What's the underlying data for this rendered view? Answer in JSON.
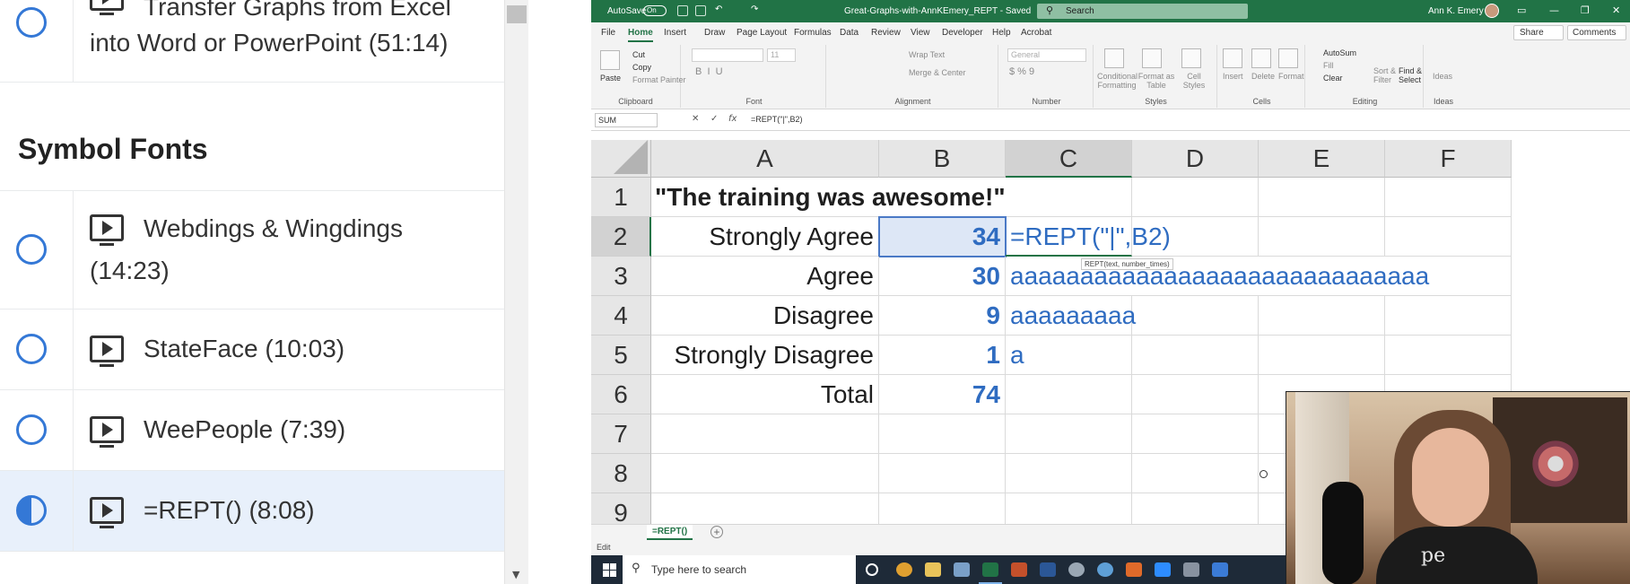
{
  "course": {
    "prev_lesson": {
      "title": "Transfer Graphs from Excel into Word or PowerPoint (51:14)"
    },
    "section_title": "Symbol Fonts",
    "lessons": [
      {
        "title": "Webdings & Wingdings (14:23)",
        "status": "not-started"
      },
      {
        "title": "StateFace (10:03)",
        "status": "not-started"
      },
      {
        "title": "WeePeople (7:39)",
        "status": "not-started"
      },
      {
        "title": "=REPT() (8:08)",
        "status": "in-progress"
      }
    ]
  },
  "excel": {
    "titlebar": {
      "autosave": "AutoSave",
      "toggle": "On",
      "filename": "Great-Graphs-with-AnnKEmery_REPT - Saved",
      "search_placeholder": "Search",
      "user": "Ann K. Emery"
    },
    "menu": [
      "File",
      "Home",
      "Insert",
      "Draw",
      "Page Layout",
      "Formulas",
      "Data",
      "Review",
      "View",
      "Developer",
      "Help",
      "Acrobat"
    ],
    "menu_active": "Home",
    "share": "Share",
    "comments": "Comments",
    "ribbon": {
      "clipboard": {
        "paste": "Paste",
        "cut": "Cut",
        "copy": "Copy",
        "format_painter": "Format Painter",
        "label": "Clipboard"
      },
      "font": {
        "label": "Font",
        "size": "11"
      },
      "alignment": {
        "wrap": "Wrap Text",
        "merge": "Merge & Center",
        "label": "Alignment"
      },
      "number": {
        "format": "General",
        "label": "Number"
      },
      "styles": {
        "conditional": "Conditional Formatting",
        "format_table": "Format as Table",
        "cell_styles": "Cell Styles",
        "label": "Styles"
      },
      "cells": {
        "insert": "Insert",
        "delete": "Delete",
        "format": "Format",
        "label": "Cells"
      },
      "editing": {
        "autosum": "AutoSum",
        "fill": "Fill",
        "clear": "Clear",
        "sort": "Sort & Filter",
        "find": "Find & Select",
        "label": "Editing"
      },
      "ideas": {
        "ideas": "Ideas",
        "label": "Ideas"
      }
    },
    "formula_bar": {
      "name_box": "SUM",
      "formula": "=REPT(\"|\",B2)"
    },
    "columns": [
      "A",
      "B",
      "C",
      "D",
      "E",
      "F"
    ],
    "rows": [
      "1",
      "2",
      "3",
      "4",
      "5",
      "6",
      "7",
      "8",
      "9"
    ],
    "cells": {
      "A1": "\"The training was awesome!\"",
      "A2": "Strongly Agree",
      "B2": "34",
      "C2": "=REPT(\"|\",B2)",
      "A3": "Agree",
      "B3": "30",
      "C3": "aaaaaaaaaaaaaaaaaaaaaaaaaaaaaa",
      "A4": "Disagree",
      "B4": "9",
      "C4": "aaaaaaaaa",
      "A5": "Strongly Disagree",
      "B5": "1",
      "C5": "a",
      "A6": "Total",
      "B6": "74"
    },
    "tooltip": "REPT(text, number_times)",
    "sheet_tab": "=REPT()",
    "status": "Edit",
    "taskbar_search": "Type here to search"
  },
  "webcam": {
    "shirt_text": "pe"
  },
  "colors": {
    "excel_green": "#217346",
    "value_blue": "#2f6cc1",
    "progress_blue": "#3478d6"
  }
}
